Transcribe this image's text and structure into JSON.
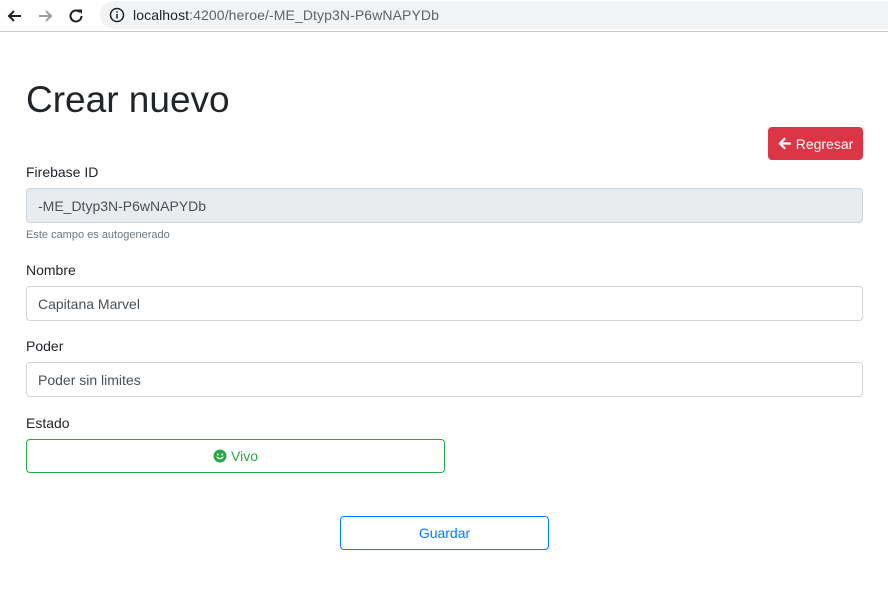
{
  "browser": {
    "url_host": "localhost",
    "url_rest": ":4200/heroe/-ME_Dtyp3N-P6wNAPYDb",
    "icons": {
      "back": "arrow-left-icon",
      "forward": "arrow-right-icon",
      "reload": "reload-icon",
      "info": "info-icon"
    }
  },
  "page": {
    "title": "Crear nuevo",
    "back_button": {
      "label": "Regresar",
      "icon": "arrow-left-icon",
      "color": "#dc3545"
    }
  },
  "form": {
    "firebase_id": {
      "label": "Firebase ID",
      "value": "-ME_Dtyp3N-P6wNAPYDb",
      "help": "Este campo es autogenerado"
    },
    "nombre": {
      "label": "Nombre",
      "value": "Capitana Marvel"
    },
    "poder": {
      "label": "Poder",
      "value": "Poder sin limites"
    },
    "estado": {
      "label": "Estado",
      "button_label": "Vivo",
      "icon": "smile-icon",
      "color": "#28a745"
    },
    "save_button": {
      "label": "Guardar",
      "color": "#007bff"
    }
  }
}
